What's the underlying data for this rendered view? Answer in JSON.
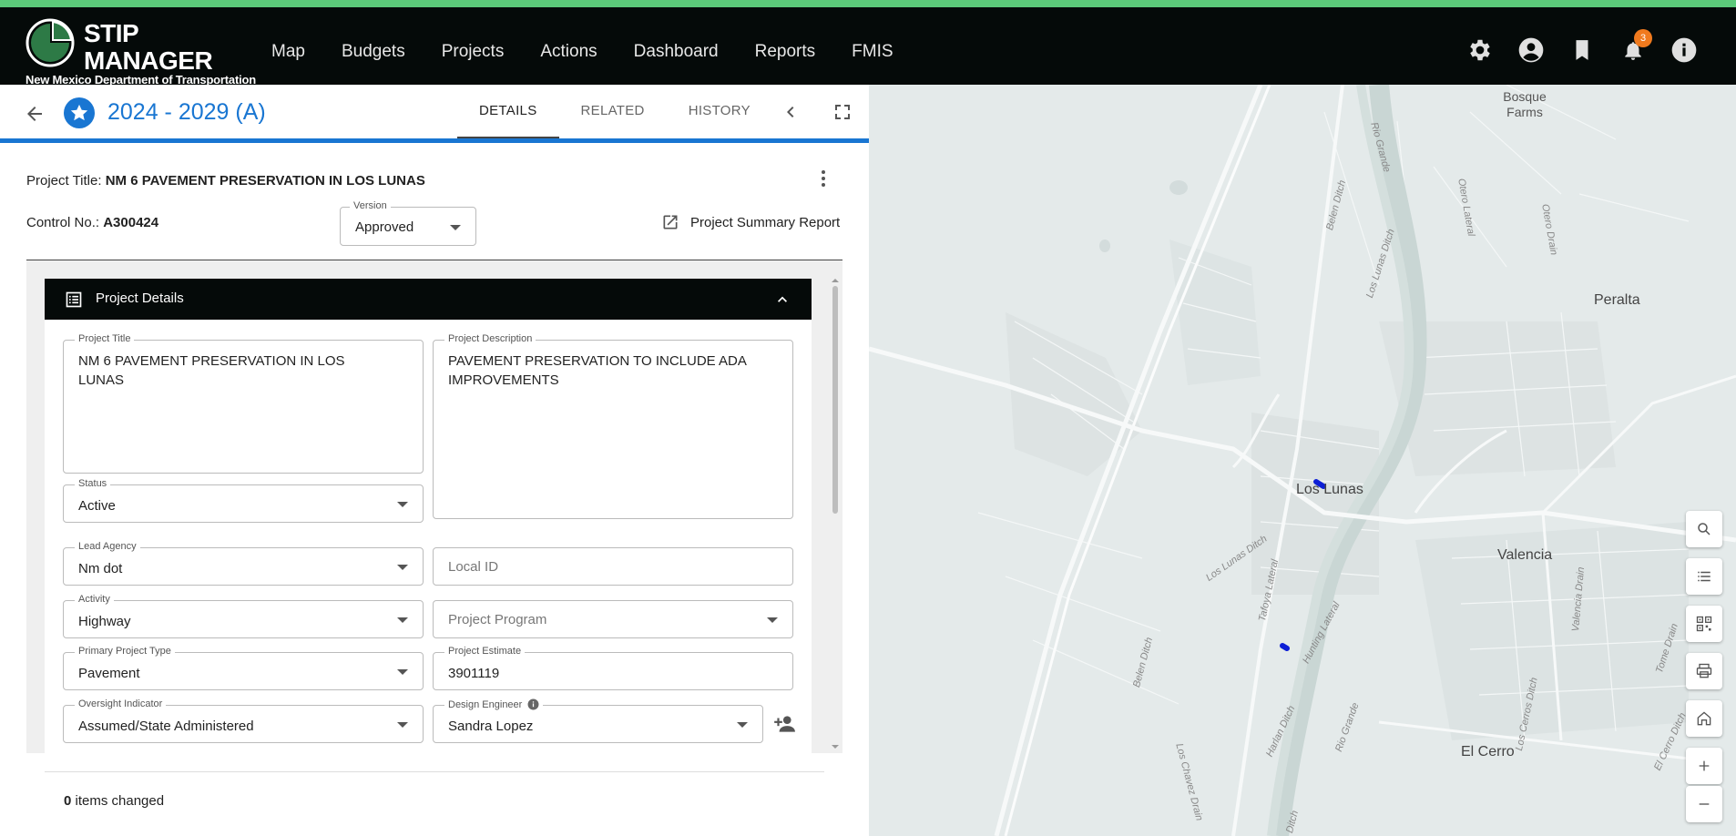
{
  "brand": {
    "line1": "STIP",
    "line2": "MANAGER",
    "subtitle": "New Mexico Department of Transportation"
  },
  "nav": [
    "Map",
    "Budgets",
    "Projects",
    "Actions",
    "Dashboard",
    "Reports",
    "FMIS"
  ],
  "header_icons": {
    "settings": "gear-icon",
    "account": "account-circle-icon",
    "bookmark": "bookmark-icon",
    "notifications": "bell-icon",
    "notification_count": "3",
    "info": "info-icon"
  },
  "panel": {
    "title": "2024 - 2029 (A)",
    "tabs": [
      "DETAILS",
      "RELATED",
      "HISTORY"
    ],
    "project_title_label": "Project Title:",
    "project_title_value": "NM 6 PAVEMENT PRESERVATION IN LOS LUNAS",
    "control_label": "Control No.:",
    "control_value": "A300424",
    "version_label": "Version",
    "version_value": "Approved",
    "summary_report": "Project Summary Report"
  },
  "section": {
    "title": "Project Details",
    "fields": {
      "project_title": {
        "label": "Project Title",
        "value": "NM 6 PAVEMENT PRESERVATION IN LOS LUNAS"
      },
      "project_description": {
        "label": "Project Description",
        "value": "PAVEMENT PRESERVATION TO INCLUDE ADA IMPROVEMENTS"
      },
      "status": {
        "label": "Status",
        "value": "Active"
      },
      "lead_agency": {
        "label": "Lead Agency",
        "value": "Nm dot"
      },
      "local_id": {
        "placeholder": "Local ID"
      },
      "activity": {
        "label": "Activity",
        "value": "Highway"
      },
      "project_program": {
        "placeholder": "Project Program"
      },
      "primary_project_type": {
        "label": "Primary Project Type",
        "value": "Pavement"
      },
      "project_estimate": {
        "label": "Project Estimate",
        "value": "3901119"
      },
      "oversight_indicator": {
        "label": "Oversight Indicator",
        "value": "Assumed/State Administered"
      },
      "design_engineer": {
        "label": "Design Engineer",
        "value": "Sandra Lopez"
      }
    }
  },
  "footer": {
    "count": "0",
    "text": "items changed"
  },
  "map": {
    "labels": {
      "bosque_farms": "Bosque Farms",
      "peralta": "Peralta",
      "los_lunas": "Los Lunas",
      "valencia": "Valencia",
      "el_cerro": "El Cerro",
      "rio_grande_n": "Rio Grande",
      "rio_grande_s": "Rio Grande",
      "otero_lateral": "Otero Lateral",
      "otero_drain": "Otero Drain",
      "belen_ditch_n": "Belen Ditch",
      "los_lunas_ditch_n": "Los Lunas Ditch",
      "los_lunas_ditch_s": "Los Lunas Ditch",
      "tafoya_lateral": "Tafoya Lateral",
      "hunting_lateral": "Hunting Lateral",
      "belen_ditch_s": "Belen Ditch",
      "harlan_ditch": "Harlan Ditch",
      "los_chavez_drain": "Los Chavez Drain",
      "valencia_drain": "Valencia Drain",
      "los_cerros_ditch": "Los Cerros Ditch",
      "tome_drain": "Tome Drain",
      "el_cerro_ditch": "El Cerro Ditch",
      "ditch_bottom": "Ditch"
    },
    "controls": [
      "search-icon",
      "list-icon",
      "qr-code-icon",
      "print-icon",
      "home-icon",
      "zoom-in-icon",
      "zoom-out-icon"
    ]
  }
}
